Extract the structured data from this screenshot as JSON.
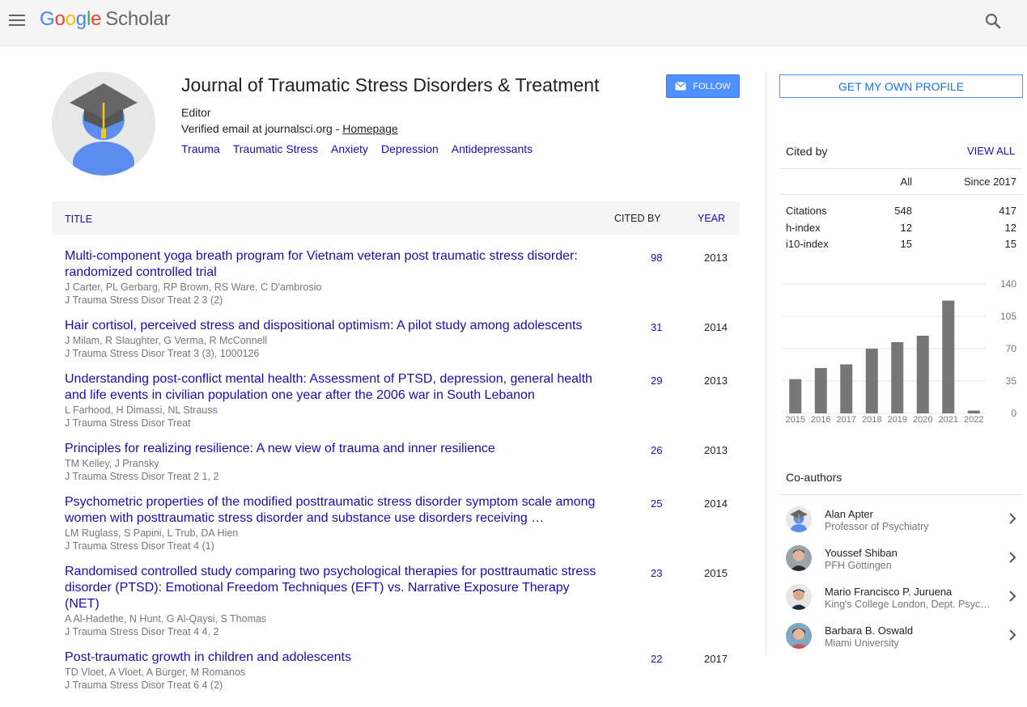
{
  "header": {
    "logo_letters": [
      "G",
      "o",
      "o",
      "g",
      "l",
      "e"
    ],
    "logo_scholar": "Scholar",
    "icons": {
      "menu": "hamburger-menu-icon",
      "search": "search-icon"
    }
  },
  "profile": {
    "name": "Journal of Traumatic Stress Disorders & Treatment",
    "role": "Editor",
    "email_prefix": "Verified email at journalsci.org - ",
    "homepage_label": "Homepage",
    "follow_label": "FOLLOW",
    "interests": [
      "Trauma",
      "Traumatic Stress",
      "Anxiety",
      "Depression",
      "Antidepressants"
    ]
  },
  "table": {
    "col_title": "TITLE",
    "col_cited": "CITED BY",
    "col_year": "YEAR",
    "articles": [
      {
        "title": "Multi-component yoga breath program for Vietnam veteran post traumatic stress disorder: randomized controlled trial",
        "authors": "J Carter, PL Gerbarg, RP Brown, RS Ware, C D'ambrosio",
        "venue": "J Trauma Stress Disor Treat 2 3 (2)",
        "cited": "98",
        "year": "2013"
      },
      {
        "title": "Hair cortisol, perceived stress and dispositional optimism: A pilot study among adolescents",
        "authors": "J Milam, R Slaughter, G Verma, R McConnell",
        "venue": "J Trauma Stress Disor Treat 3 (3), 1000126",
        "cited": "31",
        "year": "2014"
      },
      {
        "title": "Understanding post-conflict mental health: Assessment of PTSD, depression, general health and life events in civilian population one year after the 2006 war in South Lebanon",
        "authors": "L Farhood, H Dimassi, NL Strauss",
        "venue": "J Trauma Stress Disor Treat",
        "cited": "29",
        "year": "2013"
      },
      {
        "title": "Principles for realizing resilience: A new view of trauma and inner resilience",
        "authors": "TM Kelley, J Pransky",
        "venue": "J Trauma Stress Disor Treat 2 1, 2",
        "cited": "26",
        "year": "2013"
      },
      {
        "title": "Psychometric properties of the modified posttraumatic stress disorder symptom scale among women with posttraumatic stress disorder and substance use disorders receiving …",
        "authors": "LM Ruglass, S Papini, L Trub, DA Hien",
        "venue": "J Trauma Stress Disor Treat 4 (1)",
        "cited": "25",
        "year": "2014"
      },
      {
        "title": "Randomised controlled study comparing two psychological therapies for posttraumatic stress disorder (PTSD): Emotional Freedom Techniques (EFT) vs. Narrative Exposure Therapy (NET)",
        "authors": "A Al-Hadethe, N Hunt, G Al-Qaysi, S Thomas",
        "venue": "J Trauma Stress Disor Treat 4 4, 2",
        "cited": "23",
        "year": "2015"
      },
      {
        "title": "Post-traumatic growth in children and adolescents",
        "authors": "TD Vloet, A Vloet, A Bürger, M Romanos",
        "venue": "J Trauma Stress Disor Treat 6 4 (2)",
        "cited": "22",
        "year": "2017"
      }
    ]
  },
  "sidebar": {
    "get_profile_label": "GET MY OWN PROFILE",
    "cited_by_label": "Cited by",
    "view_all_label": "VIEW ALL",
    "stats_headers": [
      "All",
      "Since 2017"
    ],
    "stats": [
      {
        "label": "Citations",
        "all": "548",
        "since": "417"
      },
      {
        "label": "h-index",
        "all": "12",
        "since": "12"
      },
      {
        "label": "i10-index",
        "all": "15",
        "since": "15"
      }
    ],
    "coauthors_label": "Co-authors",
    "coauthors": [
      {
        "name": "Alan Apter",
        "affiliation": "Professor of Psychiatry",
        "avatar": "default-scholar-avatar-icon"
      },
      {
        "name": "Youssef Shiban",
        "affiliation": "PFH Göttingen",
        "avatar": "photo-avatar"
      },
      {
        "name": "Mario Francisco P. Juruena",
        "affiliation": "King's College London, Dept. Psychological Medicine",
        "avatar": "photo-avatar"
      },
      {
        "name": "Barbara B. Oswald",
        "affiliation": "Miami University",
        "avatar": "photo-avatar"
      }
    ]
  },
  "colors": {
    "link": "#1a0dab",
    "follow_bg": "#4d90fe",
    "bar": "#777777",
    "header_bg": "#f5f5f5"
  },
  "chart_data": {
    "type": "bar",
    "categories": [
      "2015",
      "2016",
      "2017",
      "2018",
      "2019",
      "2020",
      "2021",
      "2022"
    ],
    "values": [
      37,
      49,
      53,
      70,
      77,
      84,
      122,
      3
    ],
    "y_ticks": [
      "0",
      "35",
      "70",
      "105",
      "140"
    ],
    "ylim": [
      0,
      140
    ],
    "grid": true
  }
}
